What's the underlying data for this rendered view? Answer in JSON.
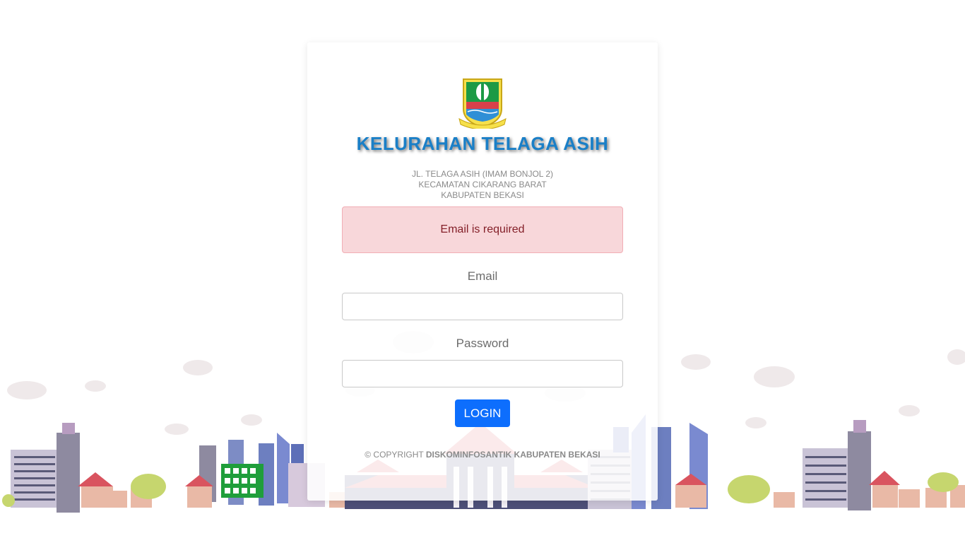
{
  "brand": {
    "title": "KELURAHAN TELAGA ASIH",
    "address_lines": [
      "JL. TELAGA ASIH (IMAM BONJOL 2)",
      "KECAMATAN CIKARANG BARAT",
      "KABUPATEN BEKASI"
    ],
    "logo_icon": "kabupaten-bekasi-emblem-icon"
  },
  "alert": {
    "message": "Email is required"
  },
  "form": {
    "email_label": "Email",
    "email_value": "",
    "password_label": "Password",
    "password_value": "",
    "login_label": "LOGIN"
  },
  "footer": {
    "prefix": "© COPYRIGHT",
    "owner": "DISKOMINFOSANTIK KABUPATEN BEKASI"
  },
  "colors": {
    "title": "#1a7fc7",
    "alert_bg": "#f8d7da",
    "alert_text": "#842029",
    "button": "#0d6efd"
  }
}
